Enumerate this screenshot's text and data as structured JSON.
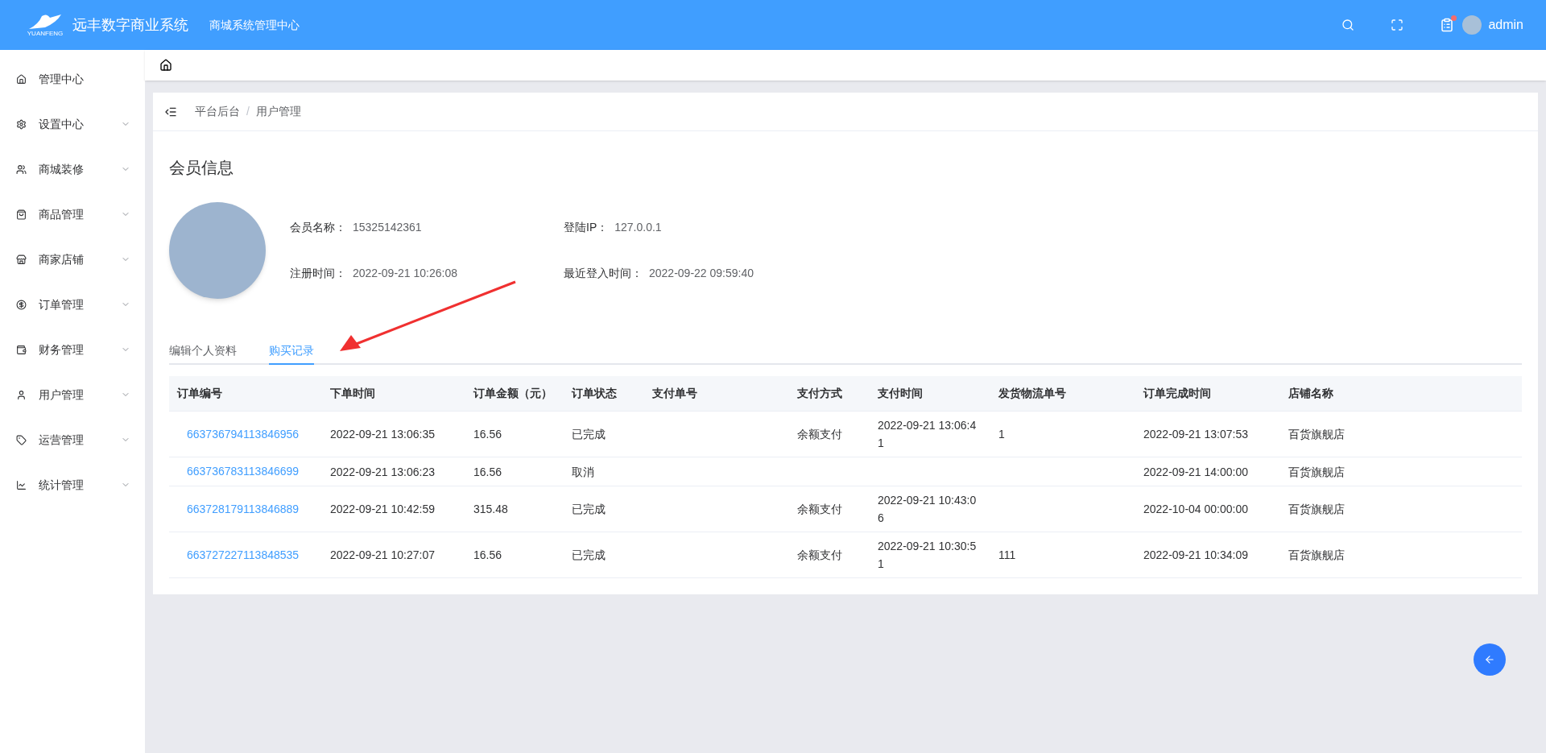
{
  "header": {
    "logo_mark": "YUANFENG",
    "system_name": "远丰数字商业系统",
    "subtitle": "商城系统管理中心",
    "has_notification": true,
    "user": "admin"
  },
  "sidebar": {
    "items": [
      {
        "label": "管理中心",
        "expandable": false
      },
      {
        "label": "设置中心",
        "expandable": true
      },
      {
        "label": "商城装修",
        "expandable": true
      },
      {
        "label": "商品管理",
        "expandable": true
      },
      {
        "label": "商家店铺",
        "expandable": true
      },
      {
        "label": "订单管理",
        "expandable": true
      },
      {
        "label": "财务管理",
        "expandable": true
      },
      {
        "label": "用户管理",
        "expandable": true
      },
      {
        "label": "运营管理",
        "expandable": true
      },
      {
        "label": "统计管理",
        "expandable": true
      }
    ]
  },
  "breadcrumb": {
    "separator": "/",
    "items": [
      "平台后台",
      "用户管理"
    ]
  },
  "member": {
    "title": "会员信息",
    "fields": [
      {
        "label": "会员名称：",
        "value": "15325142361"
      },
      {
        "label": "登陆IP：",
        "value": "127.0.0.1"
      },
      {
        "label": "注册时间：",
        "value": "2022-09-21 10:26:08"
      },
      {
        "label": "最近登入时间：",
        "value": "2022-09-22 09:59:40"
      }
    ]
  },
  "tabs": [
    {
      "label": "编辑个人资料",
      "selected": false
    },
    {
      "label": "购买记录",
      "selected": true
    }
  ],
  "table": {
    "columns": [
      "订单编号",
      "下单时间",
      "订单金额（元）",
      "订单状态",
      "支付单号",
      "支付方式",
      "支付时间",
      "发货物流单号",
      "订单完成时间",
      "店铺名称"
    ],
    "rows": [
      [
        "663736794113846956",
        "2022-09-21 13:06:35",
        "16.56",
        "已完成",
        "",
        "余额支付",
        "2022-09-21 13:06:41",
        "1",
        "2022-09-21 13:07:53",
        "百货旗舰店"
      ],
      [
        "663736783113846699",
        "2022-09-21 13:06:23",
        "16.56",
        "取消",
        "",
        "",
        "",
        "",
        "2022-09-21 14:00:00",
        "百货旗舰店"
      ],
      [
        "663728179113846889",
        "2022-09-21 10:42:59",
        "315.48",
        "已完成",
        "",
        "余额支付",
        "2022-09-21 10:43:06",
        "",
        "2022-10-04 00:00:00",
        "百货旗舰店"
      ],
      [
        "663727227113848535",
        "2022-09-21 10:27:07",
        "16.56",
        "已完成",
        "",
        "余额支付",
        "2022-09-21 10:30:51",
        "111",
        "2022-09-21 10:34:09",
        "百货旗舰店"
      ]
    ]
  }
}
